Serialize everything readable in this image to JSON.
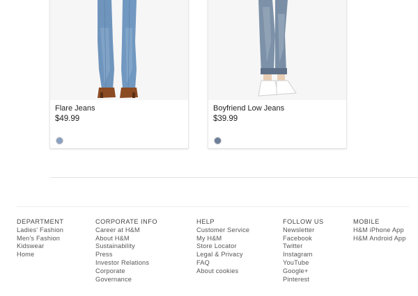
{
  "products": [
    {
      "name": "Flare Jeans",
      "price": "$49.99",
      "swatch_color": "#8aa0c0"
    },
    {
      "name": "Boyfriend Low Jeans",
      "price": "$39.99",
      "swatch_color": "#6e7f9a"
    }
  ],
  "footer": {
    "columns": [
      {
        "heading": "DEPARTMENT",
        "links": [
          "Ladies' Fashion",
          "Men's Fashion",
          "Kidswear",
          "Home"
        ]
      },
      {
        "heading": "CORPORATE INFO",
        "links": [
          "Career at H&M",
          "About H&M",
          "Sustainability",
          "Press",
          "Investor Relations",
          "Corporate",
          "Governance"
        ]
      },
      {
        "heading": "HELP",
        "links": [
          "Customer Service",
          "My H&M",
          "Store Locator",
          "Legal & Privacy",
          "FAQ",
          "About cookies"
        ]
      },
      {
        "heading": "FOLLOW US",
        "links": [
          "Newsletter",
          "Facebook",
          "Twitter",
          "Instagram",
          "YouTube",
          "Google+",
          "Pinterest"
        ]
      },
      {
        "heading": "MOBILE",
        "links": [
          "H&M iPhone App",
          "H&M Android App"
        ]
      }
    ]
  }
}
